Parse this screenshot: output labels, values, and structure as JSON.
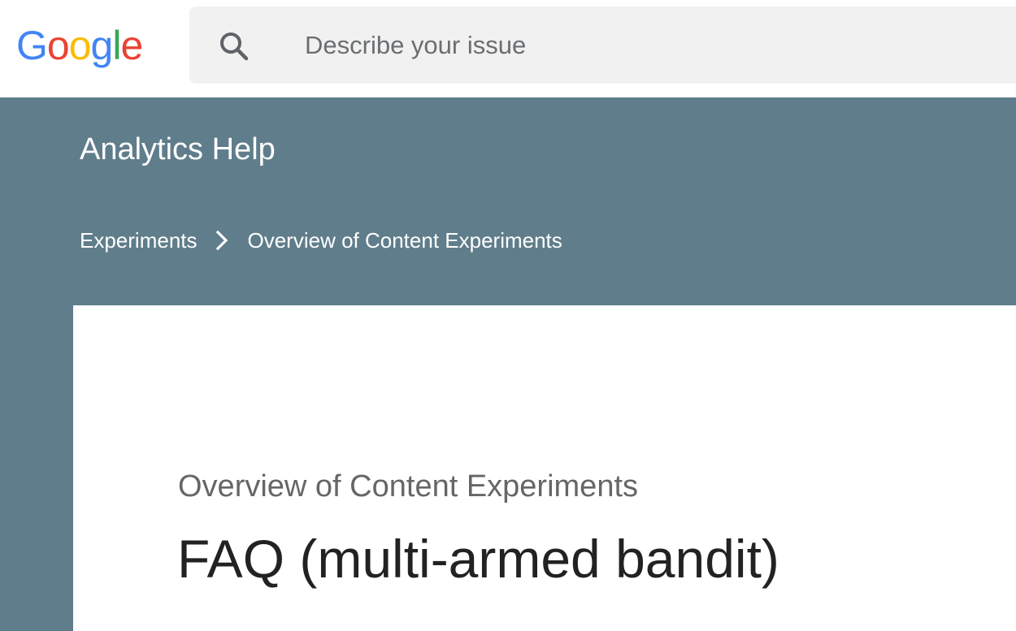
{
  "header": {
    "logo": {
      "letters": [
        "G",
        "o",
        "o",
        "g",
        "l",
        "e"
      ],
      "colors": [
        "#4285F4",
        "#EA4335",
        "#FBBC05",
        "#4285F4",
        "#34A853",
        "#EA4335"
      ]
    },
    "search": {
      "placeholder": "Describe your issue",
      "value": ""
    }
  },
  "banner": {
    "background_color": "#607d8b",
    "product_title": "Analytics Help",
    "breadcrumb": [
      {
        "label": "Experiments"
      },
      {
        "label": "Overview of Content Experiments"
      }
    ]
  },
  "article": {
    "section": "Overview of Content Experiments",
    "title": "FAQ (multi-armed bandit)"
  },
  "icons": {
    "search": "search-icon",
    "breadcrumb_separator": "chevron-right-icon"
  }
}
